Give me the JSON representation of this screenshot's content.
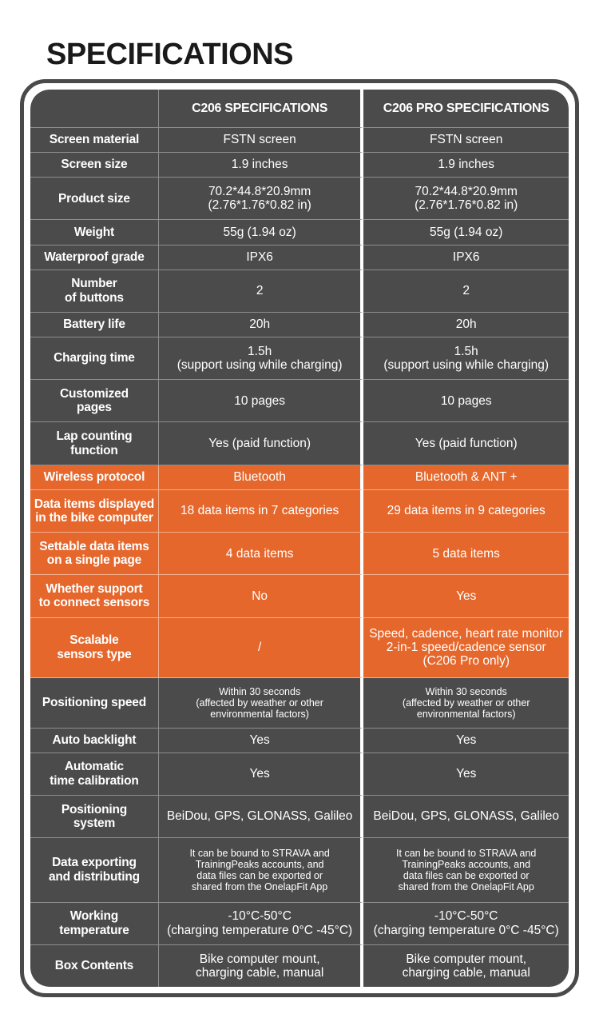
{
  "page": {
    "title": "SPECIFICATIONS"
  },
  "colors": {
    "accent_orange": "#E5672C",
    "panel_gray": "#4B4B4B",
    "grid_line": "#8E8E8E",
    "text": "#FFFFFF",
    "title_text": "#1A1A1A",
    "background": "#FFFFFF"
  },
  "table": {
    "columns": [
      {
        "key": "label",
        "header": ""
      },
      {
        "key": "c206",
        "header": "C206 SPECIFICATIONS"
      },
      {
        "key": "c206pro",
        "header": "C206 PRO SPECIFICATIONS"
      }
    ],
    "rows": [
      {
        "label": "Screen material",
        "c206": [
          "FSTN screen"
        ],
        "c206pro": [
          "FSTN screen"
        ],
        "highlight": false
      },
      {
        "label": "Screen size",
        "c206": [
          "1.9 inches"
        ],
        "c206pro": [
          "1.9 inches"
        ],
        "highlight": false
      },
      {
        "label": "Product size",
        "c206": [
          "70.2*44.8*20.9mm",
          "(2.76*1.76*0.82 in)"
        ],
        "c206pro": [
          "70.2*44.8*20.9mm",
          "(2.76*1.76*0.82 in)"
        ],
        "highlight": false
      },
      {
        "label": "Weight",
        "c206": [
          "55g (1.94 oz)"
        ],
        "c206pro": [
          "55g (1.94 oz)"
        ],
        "highlight": false
      },
      {
        "label": "Waterproof grade",
        "c206": [
          "IPX6"
        ],
        "c206pro": [
          "IPX6"
        ],
        "highlight": false
      },
      {
        "label": "Number\nof buttons",
        "c206": [
          "2"
        ],
        "c206pro": [
          "2"
        ],
        "highlight": false
      },
      {
        "label": "Battery life",
        "c206": [
          "20h"
        ],
        "c206pro": [
          "20h"
        ],
        "highlight": false
      },
      {
        "label": "Charging time",
        "c206": [
          "1.5h",
          "(support using while charging)"
        ],
        "c206pro": [
          "1.5h",
          "(support using while charging)"
        ],
        "highlight": false
      },
      {
        "label": "Customized\npages",
        "c206": [
          "10 pages"
        ],
        "c206pro": [
          "10 pages"
        ],
        "highlight": false
      },
      {
        "label": "Lap counting\nfunction",
        "c206": [
          "Yes (paid function)"
        ],
        "c206pro": [
          "Yes (paid function)"
        ],
        "highlight": false
      },
      {
        "label": "Wireless protocol",
        "c206": [
          "Bluetooth"
        ],
        "c206pro": [
          "Bluetooth & ANT +"
        ],
        "highlight": true
      },
      {
        "label": "Data items displayed\nin the bike computer",
        "c206": [
          "18 data items in 7 categories"
        ],
        "c206pro": [
          "29 data items in 9 categories"
        ],
        "highlight": true
      },
      {
        "label": "Settable data items\non a single page",
        "c206": [
          "4 data items"
        ],
        "c206pro": [
          "5 data items"
        ],
        "highlight": true
      },
      {
        "label": "Whether support\nto connect sensors",
        "c206": [
          "No"
        ],
        "c206pro": [
          "Yes"
        ],
        "highlight": true
      },
      {
        "label": "Scalable\nsensors type",
        "c206": [
          "/"
        ],
        "c206pro": [
          "Speed, cadence, heart rate monitor",
          "2-in-1 speed/cadence sensor",
          "(C206 Pro only)"
        ],
        "highlight": true
      },
      {
        "label": "Positioning speed",
        "c206": [
          "Within 30 seconds",
          "(affected by weather or other",
          "environmental factors)"
        ],
        "c206pro": [
          "Within 30 seconds",
          "(affected by weather or other",
          "environmental factors)"
        ],
        "highlight": false,
        "small_value": true
      },
      {
        "label": "Auto backlight",
        "c206": [
          "Yes"
        ],
        "c206pro": [
          "Yes"
        ],
        "highlight": false
      },
      {
        "label": "Automatic\ntime calibration",
        "c206": [
          "Yes"
        ],
        "c206pro": [
          "Yes"
        ],
        "highlight": false
      },
      {
        "label": "Positioning\nsystem",
        "c206": [
          "BeiDou, GPS, GLONASS, Galileo"
        ],
        "c206pro": [
          "BeiDou, GPS, GLONASS, Galileo"
        ],
        "highlight": false
      },
      {
        "label": "Data exporting\nand distributing",
        "c206": [
          "It can be bound to STRAVA and",
          "TrainingPeaks accounts, and",
          "data files can be exported or",
          "shared from the OnelapFit App"
        ],
        "c206pro": [
          "It can be bound to STRAVA and",
          "TrainingPeaks accounts, and",
          "data files can be exported or",
          "shared from the OnelapFit App"
        ],
        "highlight": false,
        "small_value": true
      },
      {
        "label": "Working\ntemperature",
        "c206": [
          "-10°C-50°C",
          "(charging temperature 0°C -45°C)"
        ],
        "c206pro": [
          "-10°C-50°C",
          "(charging temperature 0°C -45°C)"
        ],
        "highlight": false
      },
      {
        "label": "Box Contents",
        "c206": [
          "Bike computer mount,",
          "charging cable, manual"
        ],
        "c206pro": [
          "Bike computer mount,",
          "charging cable, manual"
        ],
        "highlight": false
      }
    ]
  }
}
